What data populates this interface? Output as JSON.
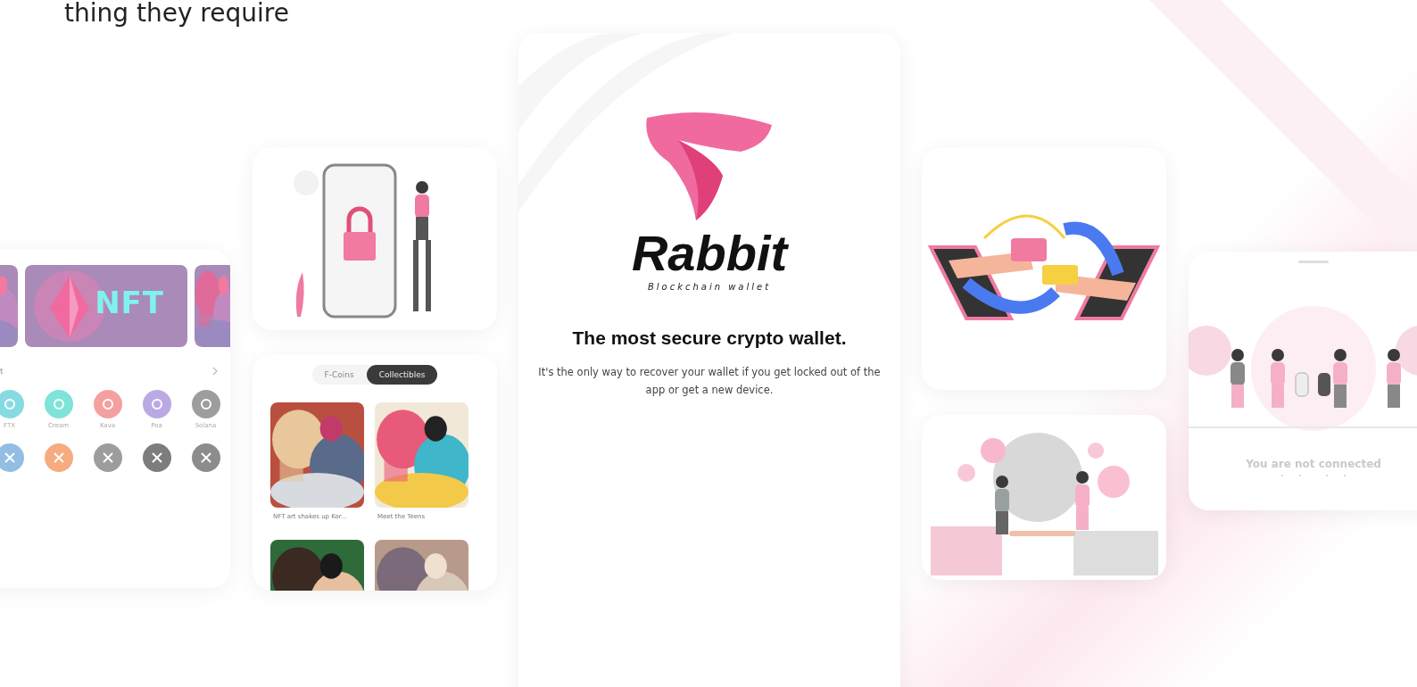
{
  "intro_fragment": "thing they require",
  "coins_screen": {
    "banner_text": "NFT",
    "section_title": "t",
    "coins": [
      {
        "label": "FTX",
        "color": "#86dbe3"
      },
      {
        "label": "Cream",
        "color": "#7ee3d9"
      },
      {
        "label": "Kava",
        "color": "#f5a0a0"
      },
      {
        "label": "Poa",
        "color": "#bba9e3"
      },
      {
        "label": "Solana",
        "color": "#9d9d9d"
      }
    ],
    "more_coins": [
      {
        "color": "#93bde3"
      },
      {
        "color": "#f7ab80"
      },
      {
        "color": "#9d9d9d"
      },
      {
        "color": "#7d7d7d"
      },
      {
        "color": "#8c8c8c"
      }
    ]
  },
  "collectibles_screen": {
    "tabs": [
      {
        "label": "F-Coins",
        "selected": false
      },
      {
        "label": "Collectibles",
        "selected": true
      }
    ],
    "items": [
      {
        "kind": "captioned",
        "caption": "NFT art shakes up Kor..."
      },
      {
        "kind": "captioned",
        "caption": "Meet the Teens"
      },
      {
        "kind": "picture"
      },
      {
        "kind": "picture"
      }
    ]
  },
  "welcome_screen": {
    "brand": "Rabbit",
    "tagline": "Blockchain wallet",
    "heading": "The most secure crypto wallet.",
    "body": "It's the only way to recover your wallet if you get locked out of the app or get a new device."
  },
  "offline_screen": {
    "message": "You are not connected"
  }
}
